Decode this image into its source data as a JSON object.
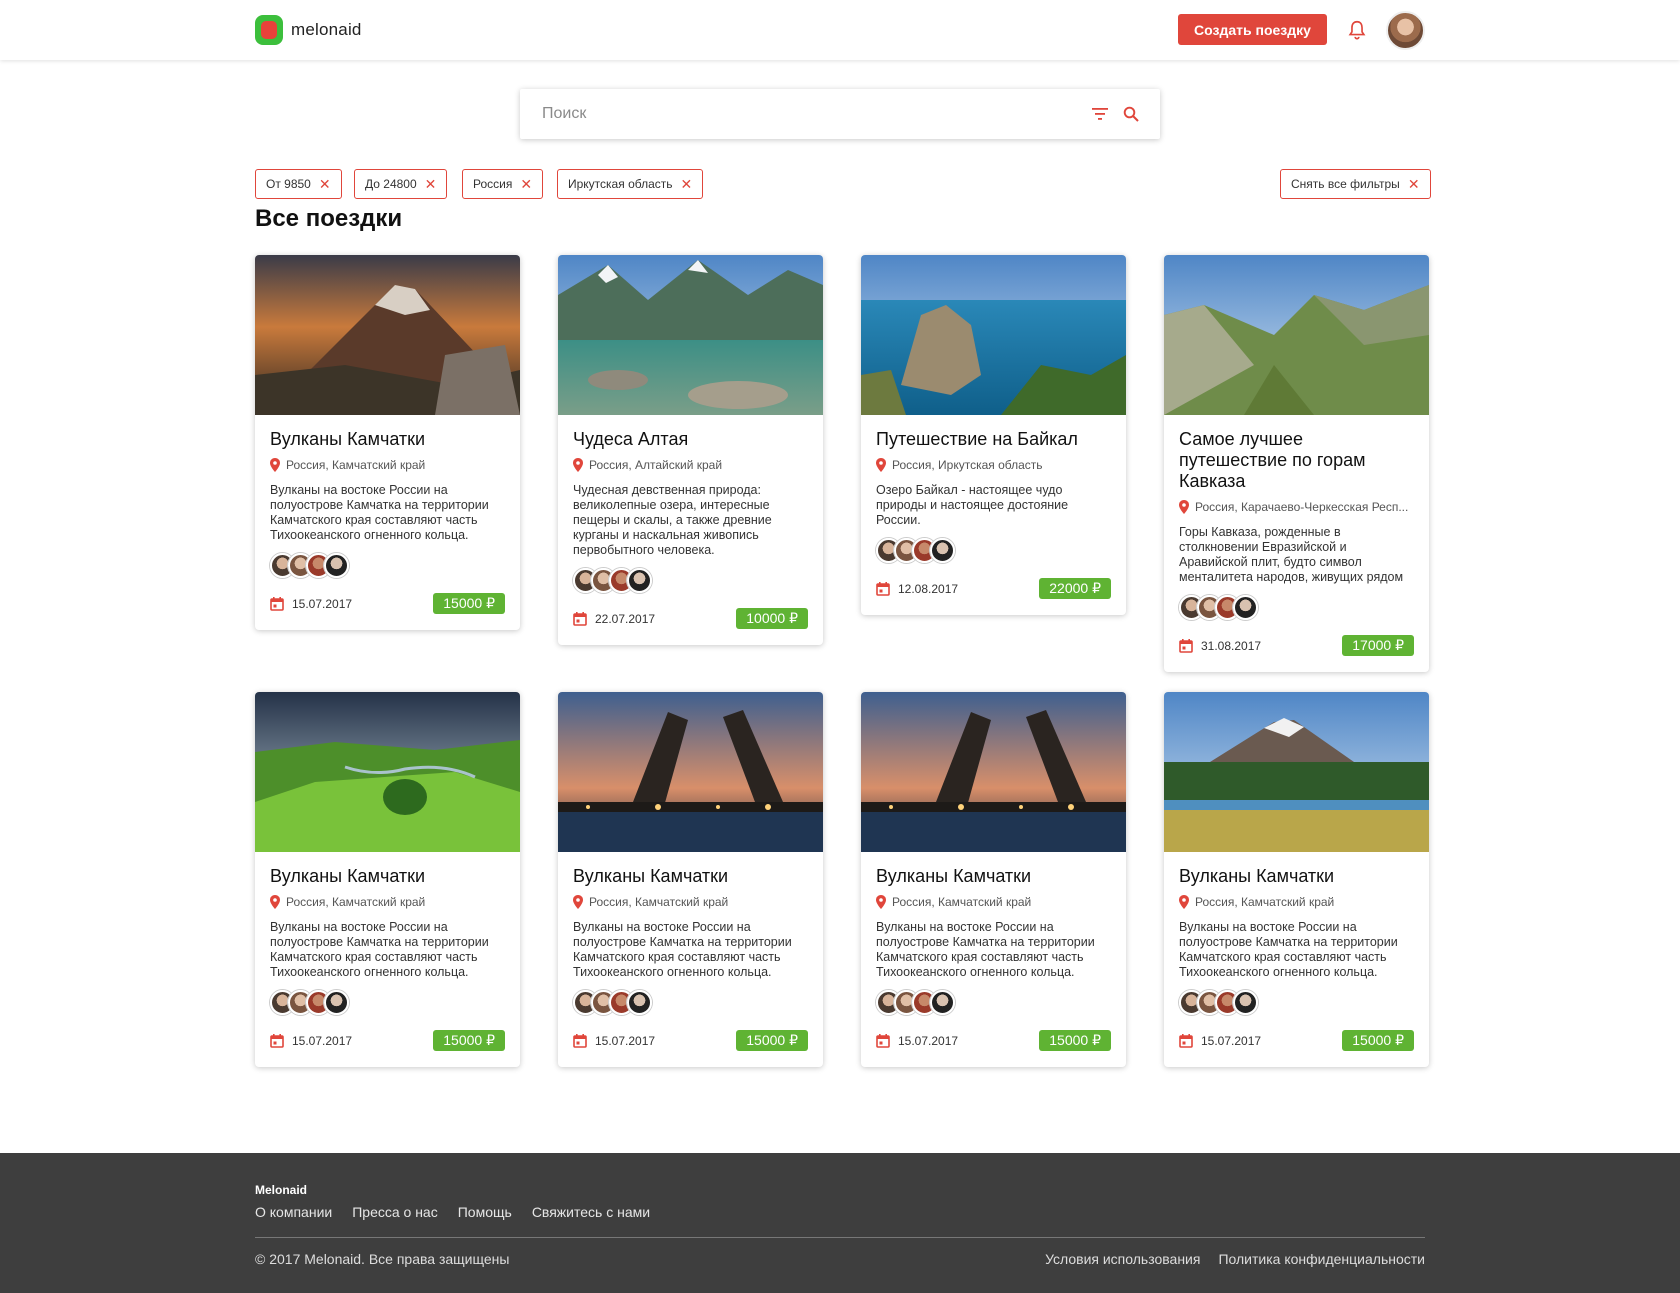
{
  "header": {
    "logo_text": "melonaid",
    "create_button": "Создать поездку"
  },
  "search": {
    "placeholder": "Поиск"
  },
  "filters": [
    {
      "label": "От 9850"
    },
    {
      "label": "До 24800"
    },
    {
      "label": "Россия"
    },
    {
      "label": "Иркутская область"
    }
  ],
  "clear_filters": "Снять все фильтры",
  "section_title": "Все поездки",
  "colors": {
    "accent_red": "#e0463b",
    "price_green": "#5fb333",
    "logo_green": "#3cbf3c",
    "footer_bg": "#3e3e3e"
  },
  "cards": [
    {
      "title": "Вулканы Камчатки",
      "location": "Россия, Камчатский край",
      "description": "Вулканы на востоке России на полуострове Камчатка на территории Камчатского края составляют часть Тихоокеанского огненного кольца.",
      "date": "15.07.2017",
      "price": "15000 ₽",
      "image": "volcano-sunset"
    },
    {
      "title": "Чудеса Алтая",
      "location": "Россия, Алтайский край",
      "description": "Чудесная девственная природа: великолепные озера, интересные пещеры и скалы, а также древние курганы и наскальная живопись первобытного человека.",
      "date": "22.07.2017",
      "price": "10000 ₽",
      "image": "mountain-lake"
    },
    {
      "title": "Путешествие на Байкал",
      "location": "Россия, Иркутская область",
      "description": "Озеро Байкал - настоящее чудо природы и настоящее достояние России.",
      "date": "12.08.2017",
      "price": "22000 ₽",
      "image": "baikal-rock"
    },
    {
      "title": "Самое лучшее путешествие по горам Кавказа",
      "location": "Россия, Карачаево-Черкесская Респ...",
      "description": "Горы Кавказа, рожденные в столкновении Евразийской и Аравийской плит, будто символ менталитета народов, живущих рядом",
      "date": "31.08.2017",
      "price": "17000 ₽",
      "image": "caucasus-valley"
    },
    {
      "title": "Вулканы Камчатки",
      "location": "Россия, Камчатский край",
      "description": "Вулканы на востоке России на полуострове Камчатка на территории Камчатского края составляют часть Тихоокеанского огненного кольца.",
      "date": "15.07.2017",
      "price": "15000 ₽",
      "image": "green-valley"
    },
    {
      "title": "Вулканы Камчатки",
      "location": "Россия, Камчатский край",
      "description": "Вулканы на востоке России на полуострове Камчатка на территории Камчатского края составляют часть Тихоокеанского огненного кольца.",
      "date": "15.07.2017",
      "price": "15000 ₽",
      "image": "drawbridge-night"
    },
    {
      "title": "Вулканы Камчатки",
      "location": "Россия, Камчатский край",
      "description": "Вулканы на востоке России на полуострове Камчатка на территории Камчатского края составляют часть Тихоокеанского огненного кольца.",
      "date": "15.07.2017",
      "price": "15000 ₽",
      "image": "drawbridge-night"
    },
    {
      "title": "Вулканы Камчатки",
      "location": "Россия, Камчатский край",
      "description": "Вулканы на востоке России на полуострове Камчатка на территории Камчатского края составляют часть Тихоокеанского огненного кольца.",
      "date": "15.07.2017",
      "price": "15000 ₽",
      "image": "mountain-forest"
    }
  ],
  "footer": {
    "brand": "Melonaid",
    "links": [
      "О компании",
      "Пресса о нас",
      "Помощь",
      "Свяжитесь с нами"
    ],
    "copyright": "© 2017 Melonaid. Все права защищены",
    "legal": [
      "Условия использования",
      "Политика конфиденциальности"
    ]
  }
}
